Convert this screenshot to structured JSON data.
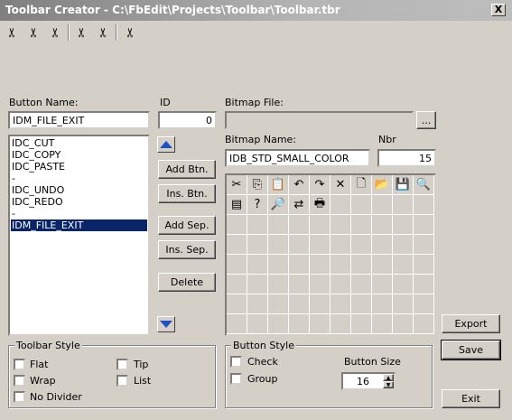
{
  "window": {
    "title": "Toolbar Creator - C:\\FbEdit\\Projects\\Toolbar\\Toolbar.tbr",
    "close_label": "X"
  },
  "preview_toolbar": {
    "icons": [
      "cut-icon",
      "cut-icon",
      "cut-icon",
      "cut-icon",
      "cut-icon",
      "cut-icon"
    ]
  },
  "button_name": {
    "label": "Button Name:",
    "value": "IDM_FILE_EXIT"
  },
  "id": {
    "label": "ID",
    "value": "0"
  },
  "button_list": {
    "items": [
      "IDC_CUT",
      "IDC_COPY",
      "IDC_PASTE",
      "-",
      "IDC_UNDO",
      "IDC_REDO",
      "-",
      "IDM_FILE_EXIT"
    ],
    "selected_index": 7
  },
  "actions": {
    "add_btn": "Add Btn.",
    "ins_btn": "Ins. Btn.",
    "add_sep": "Add Sep.",
    "ins_sep": "Ins. Sep.",
    "delete": "Delete"
  },
  "bitmap_file": {
    "label": "Bitmap File:",
    "value": "",
    "browse_label": "..."
  },
  "bitmap_name": {
    "label": "Bitmap Name:",
    "value": "IDB_STD_SMALL_COLOR"
  },
  "nbr": {
    "label": "Nbr",
    "value": "15"
  },
  "bitmap_grid_icons": [
    "cut-icon",
    "copy-icon",
    "paste-icon",
    "undo-icon",
    "redo-icon",
    "delete-icon",
    "new-file-icon",
    "open-folder-icon",
    "save-icon",
    "print-preview-icon",
    "properties-icon",
    "help-pointer-icon",
    "find-icon",
    "replace-icon",
    "print-icon"
  ],
  "toolbar_style": {
    "title": "Toolbar Style",
    "flat": "Flat",
    "tip": "Tip",
    "wrap": "Wrap",
    "list": "List",
    "no_divider": "No Divider"
  },
  "button_style": {
    "title": "Button Style",
    "check": "Check",
    "group": "Group",
    "size_label": "Button Size",
    "size_value": "16"
  },
  "right_buttons": {
    "export": "Export",
    "save": "Save",
    "exit": "Exit"
  }
}
